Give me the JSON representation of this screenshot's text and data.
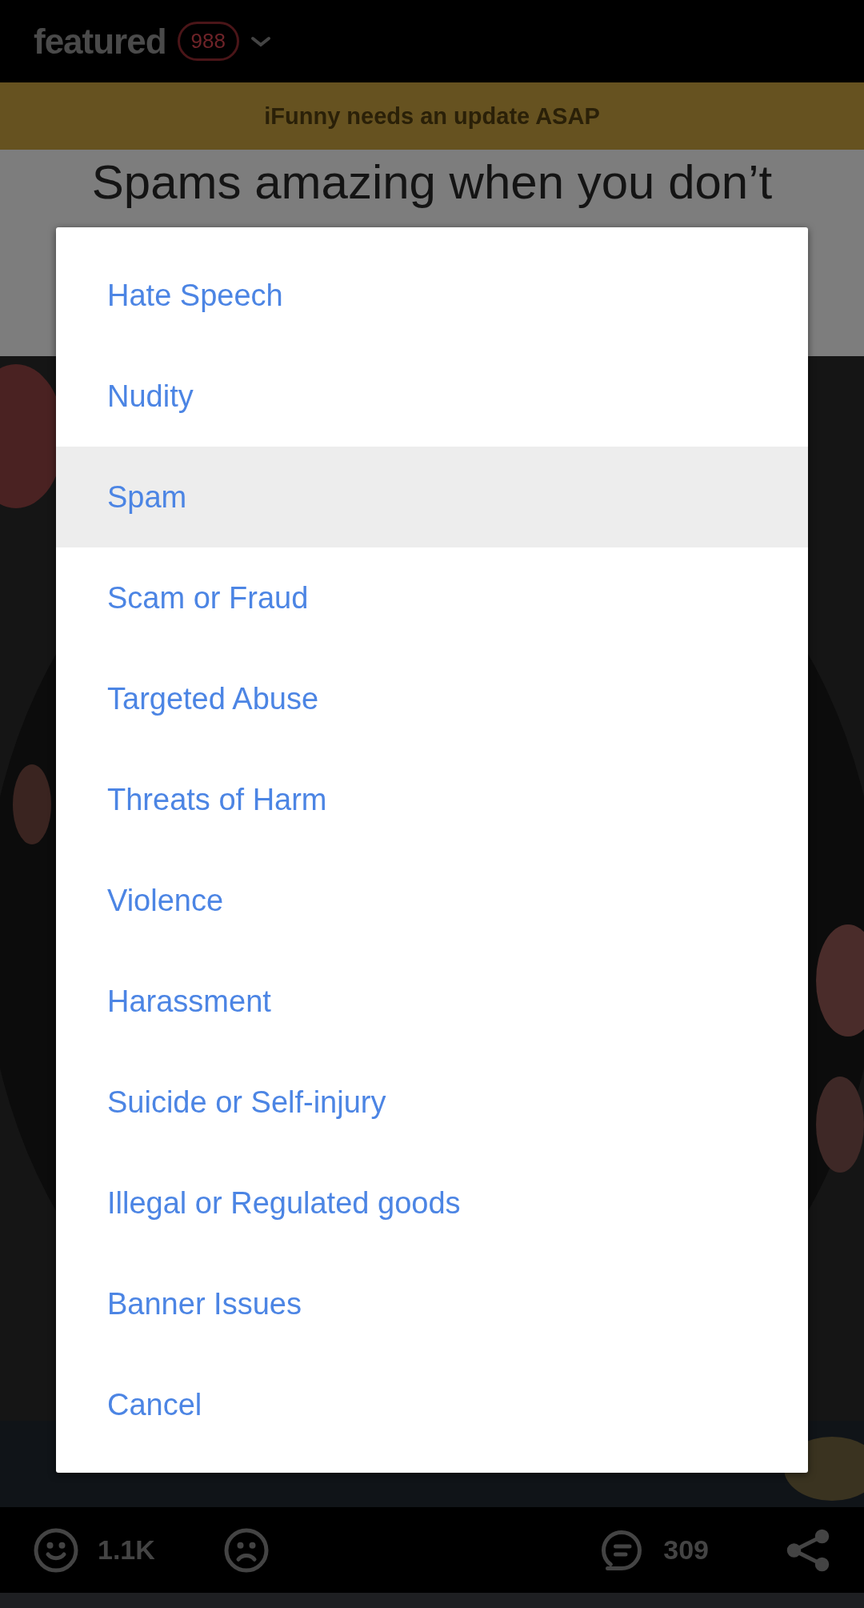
{
  "header": {
    "title": "featured",
    "count": "988"
  },
  "banner": "iFunny needs an update ASAP",
  "meme_caption": "Spams amazing when you don’t",
  "report_options": [
    {
      "label": "Hate Speech",
      "selected": false
    },
    {
      "label": "Nudity",
      "selected": false
    },
    {
      "label": "Spam",
      "selected": true
    },
    {
      "label": "Scam or Fraud",
      "selected": false
    },
    {
      "label": "Targeted Abuse",
      "selected": false
    },
    {
      "label": "Threats of Harm",
      "selected": false
    },
    {
      "label": "Violence",
      "selected": false
    },
    {
      "label": "Harassment",
      "selected": false
    },
    {
      "label": "Suicide or Self-injury",
      "selected": false
    },
    {
      "label": "Illegal or Regulated goods",
      "selected": false
    },
    {
      "label": "Banner Issues",
      "selected": false
    },
    {
      "label": "Cancel",
      "selected": false
    }
  ],
  "actions": {
    "smile_count": "1.1K",
    "comment_count": "309"
  }
}
